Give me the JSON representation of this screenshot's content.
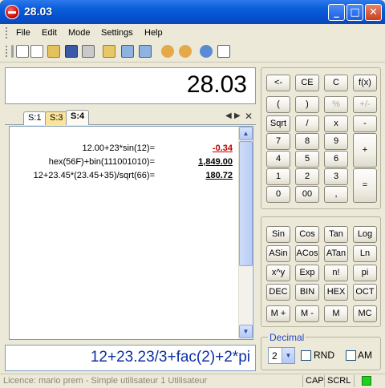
{
  "window": {
    "title": "28.03"
  },
  "menu": [
    "File",
    "Edit",
    "Mode",
    "Settings",
    "Help"
  ],
  "display": {
    "value": "28.03"
  },
  "tabs": [
    "S:1",
    "S:3",
    "S:4"
  ],
  "results": [
    {
      "expr": "12.00+23*sin(12)=",
      "value": "-0.34",
      "color": "#c00000"
    },
    {
      "expr": "hex(56F)+bin(111001010)=",
      "value": "1,849.00",
      "color": "#000000"
    },
    {
      "expr": "12+23.45*(23.45+35)/sqrt(66)=",
      "value": "180.72",
      "color": "#000000"
    }
  ],
  "input": {
    "text": "12+23.23/3+fac(2)+2*pi"
  },
  "keypad_top": [
    "<-",
    "CE",
    "C",
    "f(x)",
    "(",
    ")",
    "%",
    "+/-",
    "Sqrt",
    "/",
    "x",
    "-",
    "7",
    "8",
    "9",
    "+",
    "4",
    "5",
    "6",
    "1",
    "2",
    "3",
    "=",
    "0",
    "00",
    ","
  ],
  "keypad_fn": [
    "Sin",
    "Cos",
    "Tan",
    "Log",
    "ASin",
    "ACos",
    "ATan",
    "Ln",
    "x^y",
    "Exp",
    "n!",
    "pi",
    "DEC",
    "BIN",
    "HEX",
    "OCT",
    "M +",
    "M -",
    "M",
    "MC"
  ],
  "decimal": {
    "label": "Decimal",
    "value": "2",
    "rnd_label": "RND",
    "am_label": "AM"
  },
  "status": {
    "licence": "Licence: mario prem - Simple utilisateur 1 Utilisateur",
    "cap": "CAP",
    "scrl": "SCRL"
  }
}
